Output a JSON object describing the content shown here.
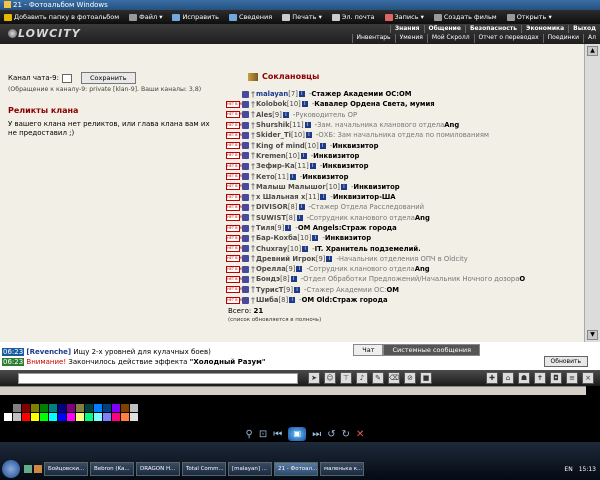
{
  "window": {
    "title": "21 - Фотоальбом Windows"
  },
  "toolbar": {
    "items": [
      {
        "label": "Добавить папку в фотоальбом",
        "icon": "folder-icon",
        "color": "#e6b800"
      },
      {
        "label": "Файл ▾",
        "icon": "file-icon",
        "color": "#999999"
      },
      {
        "label": "Исправить",
        "icon": "fix-icon",
        "color": "#6fa8dc"
      },
      {
        "label": "Сведения",
        "icon": "info-icon",
        "color": "#6fa8dc"
      },
      {
        "label": "Печать ▾",
        "icon": "print-icon",
        "color": "#cccccc"
      },
      {
        "label": "Эл. почта",
        "icon": "mail-icon",
        "color": "#cccccc"
      },
      {
        "label": "Запись ▾",
        "icon": "record-icon",
        "color": "#e06666"
      },
      {
        "label": "Создать фильм",
        "icon": "film-icon",
        "color": "#999999"
      },
      {
        "label": "Открыть ▾",
        "icon": "open-icon",
        "color": "#999999"
      }
    ]
  },
  "game": {
    "logo": "LOWCITY",
    "nav1": [
      "Знания",
      "Общение",
      "Безопасность",
      "Экономика",
      "Выход"
    ],
    "nav2": [
      "Инвентарь",
      "Умения",
      "Мой Скролл",
      "Отчет о переводах",
      "Поединки",
      "Ал"
    ]
  },
  "left": {
    "channel_label": "Канал чата-9:",
    "save_label": "Сохранить",
    "hint": "(Обращение к каналу-9: private [klan-9]. Ваши каналы: 3,8)",
    "relics_title": "Реликты клана",
    "relics_text": "У вашего клана нет реликтов, или глава клана вам их не предоставил ;)"
  },
  "clan": {
    "title": "Соклановцы",
    "members": [
      {
        "nick": "malayan",
        "lvl": "[7]",
        "role": "Стажер Академии ОС: ",
        "role_bold": "ОМ",
        "gray": false,
        "badge": ""
      },
      {
        "nick": "Kolobok",
        "lvl": "[10]",
        "role": "Кавалер Ордена Света",
        "role_bold": ", мумия",
        "gray": false,
        "badge": "НЕТ В ИГРЕ"
      },
      {
        "nick": "Ales",
        "lvl": "[9]",
        "role": "Руководитель ОР",
        "role_bold": "",
        "gray": true,
        "badge": "НЕТ В ИГРЕ"
      },
      {
        "nick": "Shurshik",
        "lvl": "[11]",
        "role": "Зам. начальника кланового отдела ",
        "role_bold": "Ang",
        "gray": true,
        "badge": "НЕТ В ИГРЕ"
      },
      {
        "nick": "Skider_Ti",
        "lvl": "[10]",
        "role": "ОХБ: Зам начальника отдела по помилованиям",
        "role_bold": "",
        "gray": true,
        "badge": "НЕТ В ИГРЕ"
      },
      {
        "nick": "King of mind",
        "lvl": "[10]",
        "role": "Инквизитор",
        "role_bold": "",
        "gray": false,
        "badge": "НЕТ В ИГРЕ"
      },
      {
        "nick": "Kremen",
        "lvl": "[10]",
        "role": "Инквизитор",
        "role_bold": "",
        "gray": false,
        "badge": "НЕТ В ИГРЕ"
      },
      {
        "nick": "Зефир-Ка",
        "lvl": "[11]",
        "role": "Инквизитор",
        "role_bold": "",
        "gray": false,
        "badge": "НЕТ В ИГРЕ"
      },
      {
        "nick": "Кето",
        "lvl": "[11]",
        "role": "Инквизитор",
        "role_bold": "",
        "gray": false,
        "badge": "НЕТ В ИГРЕ"
      },
      {
        "nick": "Малыш Малышог",
        "lvl": "[10]",
        "role": "Инквизитор",
        "role_bold": "",
        "gray": false,
        "badge": "НЕТ В ИГРЕ"
      },
      {
        "nick": "х Шальная х",
        "lvl": "[11]",
        "role": "Инквизитор-ША",
        "role_bold": "",
        "gray": false,
        "badge": "НЕТ В ИГРЕ"
      },
      {
        "nick": "DIVISOR",
        "lvl": "[8]",
        "role": "Стажер Отдела Расследований",
        "role_bold": "",
        "gray": true,
        "badge": "НЕТ В ИГРЕ"
      },
      {
        "nick": "SUWIST",
        "lvl": "[8]",
        "role": "Сотрудник кланового отдела ",
        "role_bold": "Ang",
        "gray": true,
        "badge": "НЕТ В ИГРЕ"
      },
      {
        "nick": "Тиля",
        "lvl": "[9]",
        "role": "ОМ Angels: ",
        "role_bold": "Страж города",
        "gray": false,
        "badge": "НЕТ В ИГРЕ"
      },
      {
        "nick": "Бар-Кохба",
        "lvl": "[10]",
        "role": "Инквизитор",
        "role_bold": "",
        "gray": false,
        "badge": "НЕТ В ИГРЕ"
      },
      {
        "nick": "Chuxray",
        "lvl": "[10]",
        "role": "IT. Хранитель подземелий.",
        "role_bold": "",
        "gray": false,
        "badge": "НЕТ В ИГРЕ"
      },
      {
        "nick": "Древний Игрок",
        "lvl": "[9]",
        "role": "Начальник отделения ОПЧ в Oldcity",
        "role_bold": "",
        "gray": true,
        "badge": "НЕТ В ИГРЕ"
      },
      {
        "nick": "Орелла",
        "lvl": "[9]",
        "role": "Сотрудник кланового отдела ",
        "role_bold": "Ang",
        "gray": true,
        "badge": "НЕТ В ИГРЕ"
      },
      {
        "nick": "Бондэ",
        "lvl": "[8]",
        "role": "Отдел Обработки Предложений/Начальник Ночного дозора ",
        "role_bold": "О",
        "gray": true,
        "badge": "НЕТ В ИГРЕ"
      },
      {
        "nick": "ТурисТ",
        "lvl": "[9]",
        "role": "Стажер Академии ОС: ",
        "role_bold": "ОМ",
        "gray": true,
        "badge": "НЕТ В ИГРЕ"
      },
      {
        "nick": "Шиба",
        "lvl": "[8]",
        "role": "ОМ Old: ",
        "role_bold": "Страж города",
        "gray": false,
        "badge": "НЕТ В ИГРЕ"
      }
    ],
    "total_label": "Всего:",
    "total": "21",
    "update_note": "(список обновляется в полночь)"
  },
  "chat": {
    "tabs": [
      "Чат",
      "Системные сообщения"
    ],
    "refresh": "Обновить",
    "line1_time": "06:23",
    "line1_name": "[Revenche]",
    "line1_text": " Ищу 2-х уровней для кулачных боев)",
    "line2_time": "06:23",
    "line2_warn": "Внимание!",
    "line2_text": " Закончилось действие эффекта ",
    "line2_quote": "\"Холодный Разум\""
  },
  "taskbar": {
    "tasks": [
      "Бойцовски...",
      "Bebron (Ka...",
      "DRAGON H...",
      "Total Comm...",
      "[malayan] ...",
      "21 - Фотоал...",
      "маленька к..."
    ],
    "lang": "EN",
    "clock": "15:13"
  },
  "palette": [
    "#000000",
    "#808080",
    "#800000",
    "#808000",
    "#008000",
    "#008080",
    "#000080",
    "#800080",
    "#808040",
    "#004040",
    "#0080ff",
    "#004080",
    "#8000ff",
    "#804000",
    "#c0c0c0",
    "#ffffff",
    "#c0c0c0",
    "#ff0000",
    "#ffff00",
    "#00ff00",
    "#00ffff",
    "#0000ff",
    "#ff00ff",
    "#ffff80",
    "#00ff80",
    "#80ffff",
    "#8080ff",
    "#ff0080",
    "#ff8040",
    "#e0e0e0"
  ]
}
